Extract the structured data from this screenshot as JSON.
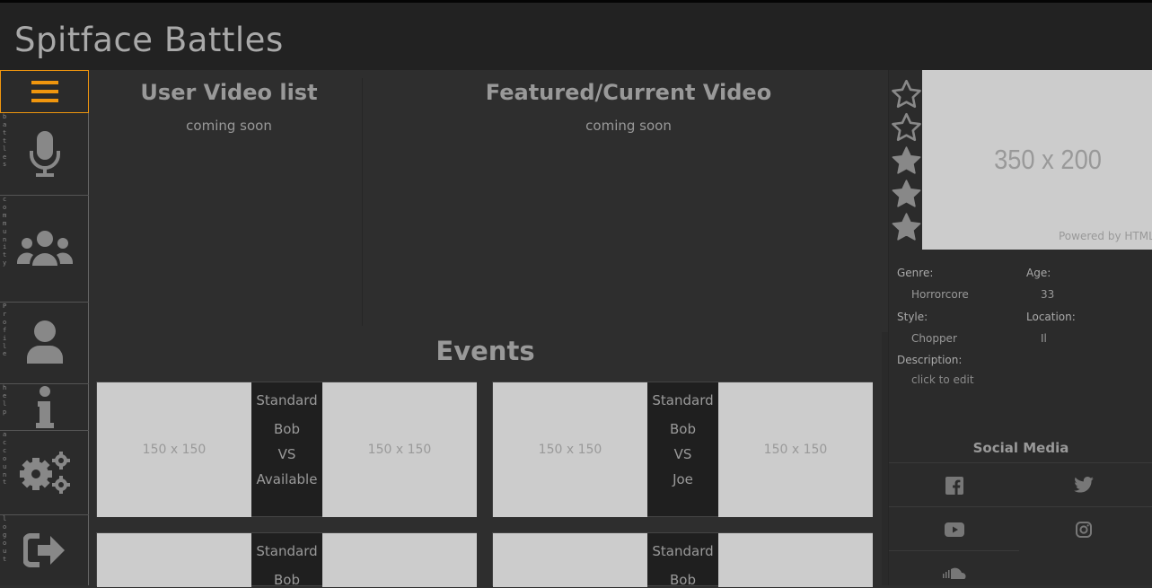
{
  "app": {
    "title": "Spitface Battles"
  },
  "sidebar": {
    "menu_icon": "hamburger-icon",
    "items": [
      {
        "id": "battles",
        "icon": "microphone-icon",
        "vertical_label": "battles"
      },
      {
        "id": "community",
        "icon": "users-icon",
        "vertical_label": "community"
      },
      {
        "id": "profile",
        "icon": "user-icon",
        "vertical_label": "Profile"
      },
      {
        "id": "help",
        "icon": "info-icon",
        "vertical_label": "help"
      },
      {
        "id": "account",
        "icon": "gears-icon",
        "vertical_label": "account"
      },
      {
        "id": "logout",
        "icon": "sign-out-icon",
        "vertical_label": "logout"
      }
    ]
  },
  "main": {
    "user_videos": {
      "title": "User Video list",
      "subtitle": "coming soon"
    },
    "featured": {
      "title": "Featured/Current Video",
      "subtitle": "coming soon"
    },
    "events": {
      "title": "Events",
      "cards": [
        {
          "left_placeholder": "150 x 150",
          "type": "Standard",
          "player1": "Bob",
          "vs": "VS",
          "player2": "Available",
          "right_placeholder": "150 x 150"
        },
        {
          "left_placeholder": "150 x 150",
          "type": "Standard",
          "player1": "Bob",
          "vs": "VS",
          "player2": "Joe",
          "right_placeholder": "150 x 150"
        },
        {
          "left_placeholder": "",
          "type": "Standard",
          "player1": "Bob",
          "vs": "",
          "player2": "",
          "right_placeholder": ""
        },
        {
          "left_placeholder": "",
          "type": "Standard",
          "player1": "Bob",
          "vs": "",
          "player2": "",
          "right_placeholder": ""
        }
      ]
    }
  },
  "profile": {
    "rating": {
      "filled": 3,
      "max": 5
    },
    "ad": {
      "size_label": "350 x 200",
      "powered": "Powered by HTML.COM"
    },
    "genre_label": "Genre:",
    "genre": "Horrorcore",
    "age_label": "Age:",
    "age": "33",
    "style_label": "Style:",
    "style": "Chopper",
    "location_label": "Location:",
    "location": "Il",
    "description_label": "Description:",
    "description": "click to edit",
    "social_title": "Social Media",
    "social": [
      "facebook-icon",
      "twitter-icon",
      "youtube-icon",
      "instagram-icon",
      "soundcloud-icon"
    ]
  },
  "colors": {
    "accent": "#f0960e",
    "background": "#2e2e2e",
    "header": "#222222",
    "placeholder": "#cccccc"
  }
}
